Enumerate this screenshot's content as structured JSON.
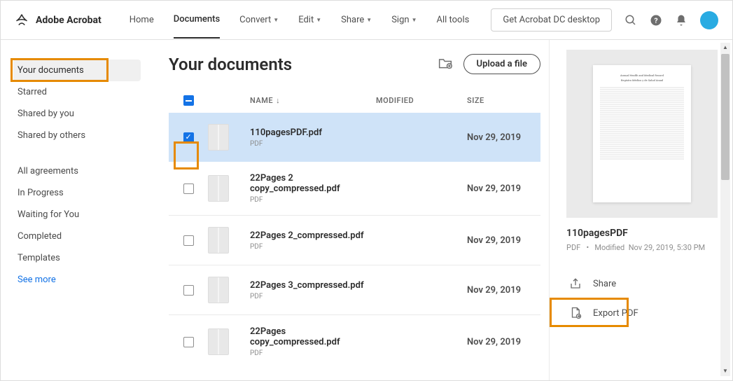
{
  "header": {
    "app_name": "Adobe Acrobat",
    "nav": [
      {
        "label": "Home",
        "id": "home"
      },
      {
        "label": "Documents",
        "id": "documents",
        "active": true
      },
      {
        "label": "Convert",
        "id": "convert",
        "dropdown": true
      },
      {
        "label": "Edit",
        "id": "edit",
        "dropdown": true
      },
      {
        "label": "Share",
        "id": "share",
        "dropdown": true
      },
      {
        "label": "Sign",
        "id": "sign",
        "dropdown": true
      },
      {
        "label": "All tools",
        "id": "alltools"
      }
    ],
    "desktop_btn": "Get Acrobat DC desktop"
  },
  "sidebar": {
    "group1": [
      {
        "label": "Your documents",
        "id": "yourdocs",
        "active": true
      },
      {
        "label": "Starred",
        "id": "starred"
      },
      {
        "label": "Shared by you",
        "id": "sharedbyyou"
      },
      {
        "label": "Shared by others",
        "id": "sharedbyothers"
      }
    ],
    "group2": [
      {
        "label": "All agreements",
        "id": "agreements"
      },
      {
        "label": "In Progress",
        "id": "inprogress"
      },
      {
        "label": "Waiting for You",
        "id": "waiting"
      },
      {
        "label": "Completed",
        "id": "completed"
      },
      {
        "label": "Templates",
        "id": "templates"
      }
    ],
    "see_more": "See more"
  },
  "content": {
    "title": "Your documents",
    "upload_label": "Upload a file",
    "columns": {
      "name": "NAME",
      "modified": "MODIFIED",
      "size": "SIZE"
    },
    "rows": [
      {
        "name": "110pagesPDF.pdf",
        "type": "PDF",
        "date": "Nov 29, 2019",
        "selected": true
      },
      {
        "name": "22Pages 2 copy_compressed.pdf",
        "type": "PDF",
        "date": "Nov 29, 2019",
        "selected": false
      },
      {
        "name": "22Pages 2_compressed.pdf",
        "type": "PDF",
        "date": "Nov 29, 2019",
        "selected": false
      },
      {
        "name": "22Pages 3_compressed.pdf",
        "type": "PDF",
        "date": "Nov 29, 2019",
        "selected": false
      },
      {
        "name": "22Pages copy_compressed.pdf",
        "type": "PDF",
        "date": "Nov 29, 2019",
        "selected": false
      }
    ]
  },
  "details": {
    "name": "110pagesPDF",
    "meta_type": "PDF",
    "meta_sep": "•",
    "meta_mod_label": "Modified",
    "meta_date": "Nov 29, 2019, 5:30 PM",
    "preview_title1": "Annual Health and Medical Record",
    "preview_title2": "Registro Médico y de Salud Anual",
    "actions": [
      {
        "label": "Share",
        "icon": "share"
      },
      {
        "label": "Export PDF",
        "icon": "export"
      }
    ]
  }
}
